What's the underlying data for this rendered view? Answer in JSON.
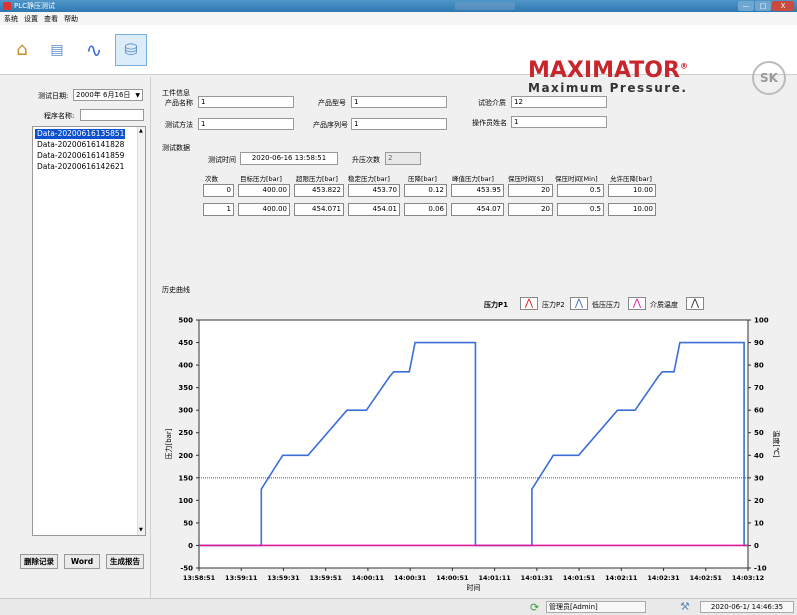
{
  "window": {
    "title": "PLC静压测试",
    "min": "—",
    "max": "□",
    "close": "X"
  },
  "menu": [
    "系统",
    "设置",
    "查看",
    "帮助"
  ],
  "toolbar": {
    "home_icon": "home-icon",
    "report_icon": "report-icon",
    "wave_icon": "wave-icon",
    "database_icon": "database-icon"
  },
  "brand": {
    "name": "MAXIMATOR",
    "reg": "®",
    "tagline": "Maximum Pressure.",
    "logo_text": "SK"
  },
  "left": {
    "date_label": "测试日期:",
    "date_value": "2000年 6月16日",
    "name_label": "程序名称:",
    "name_value": "",
    "files": [
      "Data-20200616135851",
      "Data-20200616141828",
      "Data-20200616141859",
      "Data-20200616142621"
    ],
    "buttons": {
      "delete": "删除记录",
      "word": "Word",
      "report": "生成报告"
    }
  },
  "info": {
    "section": "工件信息",
    "product_name_label": "产品名称",
    "product_name": "1",
    "product_model_label": "产品型号",
    "product_model": "1",
    "medium_label": "试验介质",
    "medium": "12",
    "method_label": "测试方法",
    "method": "1",
    "serial_label": "产品序列号",
    "serial": "1",
    "operator_label": "操作员姓名",
    "operator": "1"
  },
  "test": {
    "section": "测试数据",
    "time_label": "测试时间",
    "time_value": "2020-06-16 13:58:51",
    "count_label": "升压次数",
    "count_value": "2",
    "headers": [
      "次数",
      "目标压力[bar]",
      "超限压力[bar]",
      "稳定压力[bar]",
      "压降[bar]",
      "峰值压力[bar]",
      "保压时间[S]",
      "保压时间[Min]",
      "允许压降[bar]"
    ],
    "rows": [
      [
        "0",
        "400.00",
        "453.822",
        "453.70",
        "0.12",
        "453.95",
        "20",
        "0.5",
        "10.00"
      ],
      [
        "1",
        "400.00",
        "454.071",
        "454.01",
        "0.06",
        "454.07",
        "20",
        "0.5",
        "10.00"
      ]
    ]
  },
  "history": {
    "section": "历史曲线"
  },
  "legend": {
    "p1": "压力P1",
    "p2": "压力P2",
    "low": "低压压力",
    "temp": "介质温度"
  },
  "chart_data": {
    "type": "line",
    "xlabel": "时间",
    "ylabel": "压力[bar]",
    "y2label": "温度[℃]",
    "ylim": [
      -50,
      500
    ],
    "y2lim": [
      -10,
      100
    ],
    "yticks": [
      "500",
      "450",
      "400",
      "350",
      "300",
      "250",
      "200",
      "150",
      "100",
      "50",
      "0",
      "-50"
    ],
    "y2ticks": [
      "100",
      "90",
      "80",
      "70",
      "60",
      "50",
      "40",
      "30",
      "20",
      "10",
      "0",
      "-10"
    ],
    "xticks": [
      "13:58:51",
      "13:59:11",
      "13:59:31",
      "13:59:51",
      "14:00:11",
      "14:00:31",
      "14:00:51",
      "14:01:11",
      "14:01:31",
      "14:01:51",
      "14:02:11",
      "14:02:31",
      "14:02:51",
      "14:03:12"
    ],
    "series": [
      {
        "name": "压力P1",
        "color": "#3b6fd6",
        "axis": "left",
        "x": [
          0,
          16.0,
          16.0,
          21.5,
          28.0,
          38.0,
          43.0,
          49.0,
          50.0,
          54.0,
          55.5,
          71.0,
          71.0,
          85.5,
          85.5,
          91.0,
          97.5,
          107.5,
          112.0,
          118.0,
          119.0,
          122.0,
          123.5,
          140.0,
          140.0,
          141.0
        ],
        "y": [
          0,
          0,
          125,
          200,
          200,
          300,
          300,
          375,
          385,
          385,
          450,
          450,
          0,
          0,
          125,
          200,
          200,
          300,
          300,
          375,
          385,
          385,
          450,
          450,
          0,
          0
        ]
      },
      {
        "name": "介质温度",
        "color": "#555555",
        "axis": "right",
        "x": [
          0,
          141
        ],
        "y": [
          30,
          30
        ]
      },
      {
        "name": "低压压力",
        "color": "#e0189a",
        "axis": "left",
        "x": [
          0,
          141
        ],
        "y": [
          0,
          0
        ]
      }
    ],
    "xrange": [
      0,
      141
    ]
  },
  "status": {
    "user": "管理员[Admin]",
    "datetime": "2020-06-1/ 14:46:35"
  }
}
